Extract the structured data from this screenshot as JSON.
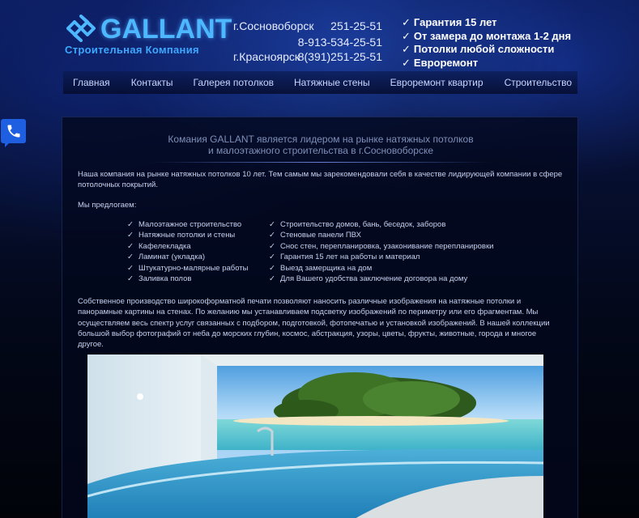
{
  "brand": {
    "name": "GALLANT",
    "subtitle": "Строительная Компания"
  },
  "contacts": {
    "city1": "г.Сосновоборск",
    "phone1": "251-25-51",
    "phone2": "8-913-534-25-51",
    "city2": "г.Красноярск",
    "phone3": "8(391)251-25-51"
  },
  "features": [
    "Гарантия 15 лет",
    "От замера до монтажа 1-2 дня",
    "Потолки любой сложности",
    "Евроремонт"
  ],
  "nav": [
    "Главная",
    "Контакты",
    "Галерея потолков",
    "Натяжные стены",
    "Евроремонт квартир",
    "Строительство"
  ],
  "content": {
    "title_line1": "Комания GALLANT является лидером на рынке натяжных потолков",
    "title_line2": "и малоэтажного строительства в г.Сосновоборске",
    "intro": "Наша компания на рынке натяжных потолков 10 лет. Тем самым мы зарекомендовали себя в качестве лидирующей компании в сфере потолочных покрытий.",
    "offer_heading": "Мы предлогаем:",
    "offers_left": [
      "Малоэтажное строительство",
      "Натяжные потолки и стены",
      "Кафелекладка",
      "Ламинат (укладка)",
      "Штукатурно-малярные работы",
      "Заливка полов"
    ],
    "offers_right": [
      "Строительство домов, бань, беседок, заборов",
      "Стеновые панели ПВХ",
      "Снос стен, перепланировка, узаконивание перепланировки",
      "Гарантия 15 лет на работы и материал",
      "Выезд замерщика на дом",
      "Для Вашего удобства заключение договора на дому"
    ],
    "check_glyph": "✓",
    "printing": "Собственное производство широкоформатной печати позволяют наносить различные изображения на натяжные потолки и панорамные картины на стенах. По желанию мы устанавливаем подсветку изображений по периметру или его фрагментам. Мы осуществляем весь спектр услуг связанных с подбором, подготовкой, фотопечатью и установкой изображений. В нашей коллекции большой выбор фотографий от неба до морских глубин, космос, абстракция, узоры, цветы, фрукты, животные, города и многое другое."
  },
  "icons": {
    "call": "phone-icon",
    "logo": "gallant-logo-icon"
  },
  "colors": {
    "brand_blue": "#4db8ff",
    "call_button": "#1d5fe0"
  }
}
